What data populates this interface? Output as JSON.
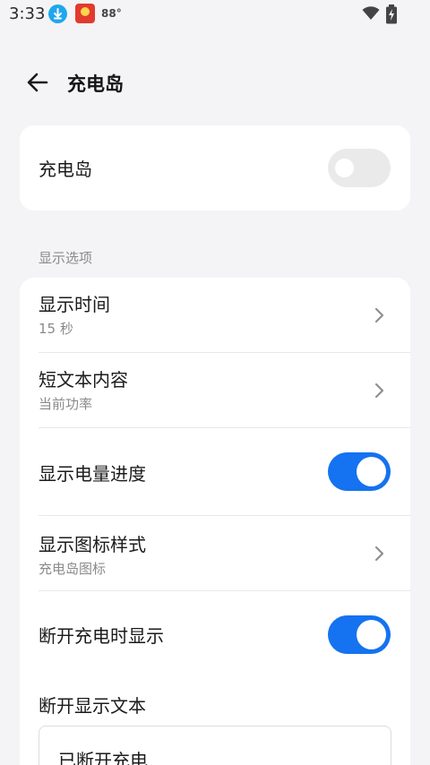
{
  "status_bar": {
    "time": "3:33",
    "temperature": "88°",
    "icons": [
      "download-icon",
      "app-notification-icon",
      "wifi-icon",
      "battery-charging-icon"
    ]
  },
  "header": {
    "title": "充电岛",
    "back_icon": "arrow-left-icon"
  },
  "main_toggle": {
    "label": "充电岛",
    "enabled": false
  },
  "section": {
    "label": "显示选项"
  },
  "options": {
    "display_time": {
      "title": "显示时间",
      "value": "15 秒"
    },
    "short_text": {
      "title": "短文本内容",
      "value": "当前功率"
    },
    "battery_progress": {
      "title": "显示电量进度",
      "enabled": true
    },
    "icon_style": {
      "title": "显示图标样式",
      "value": "充电岛图标"
    },
    "show_on_disconnect": {
      "title": "断开充电时显示",
      "enabled": true
    },
    "disconnect_text": {
      "title": "断开显示文本",
      "value": "已断开充电"
    }
  },
  "colors": {
    "accent": "#1572f0",
    "background": "#f4f4f6",
    "card": "#ffffff",
    "secondary_text": "#8a8a8a",
    "toggle_off": "#eaeaeb"
  }
}
